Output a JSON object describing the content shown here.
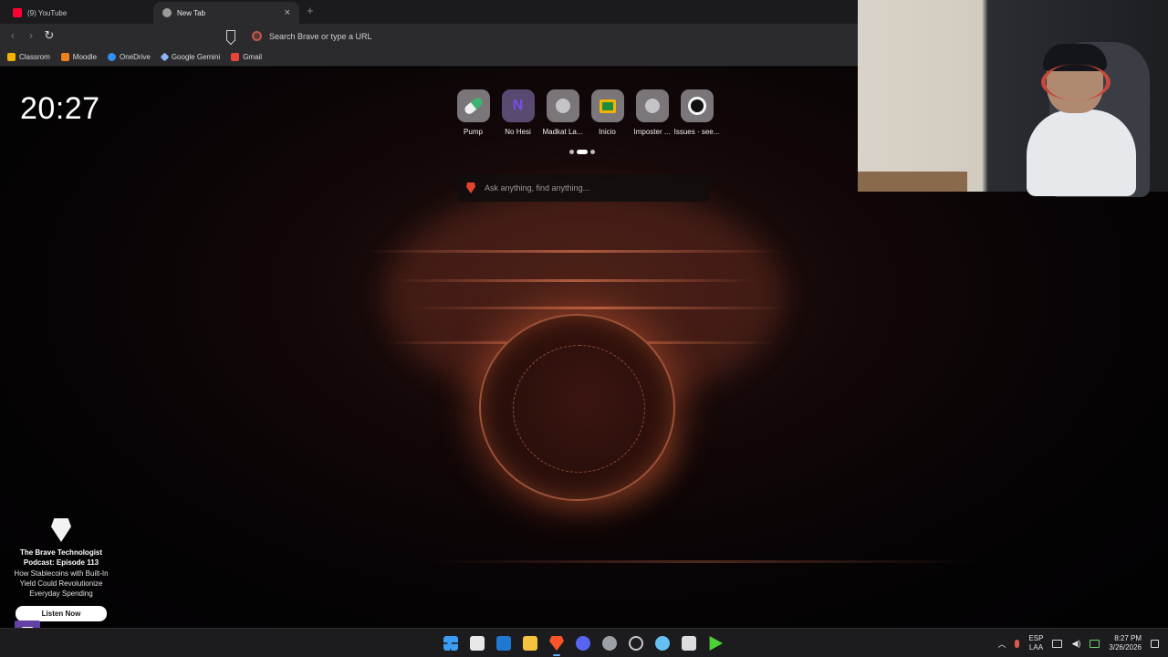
{
  "browser": {
    "tabs": [
      {
        "title": "(9) YouTube",
        "active": false,
        "favicon_color": "#ff0033"
      },
      {
        "title": "New Tab",
        "active": true,
        "favicon_color": "#9a9a9a"
      }
    ],
    "address_placeholder": "Search Brave or type a URL",
    "bookmarks": [
      {
        "label": "Classrom",
        "color": "#f2b400"
      },
      {
        "label": "Moodle",
        "color": "#f0801a"
      },
      {
        "label": "OneDrive",
        "color": "#2f8ff3"
      },
      {
        "label": "Google Gemini",
        "color": "#8ab4f8"
      },
      {
        "label": "Gmail",
        "color": "#ea4335"
      }
    ]
  },
  "new_tab": {
    "clock": "20:27",
    "top_sites": [
      {
        "label": "Pump",
        "icon": "pill-icon"
      },
      {
        "label": "No Hesi",
        "icon": "nohesi-icon"
      },
      {
        "label": "Madkat La...",
        "icon": "globe-icon"
      },
      {
        "label": "Inicio",
        "icon": "classroom-icon"
      },
      {
        "label": "Imposter ...",
        "icon": "globe-icon"
      },
      {
        "label": "Issues · see...",
        "icon": "github-icon"
      }
    ],
    "search_placeholder": "Ask anything, find anything...",
    "promo": {
      "heading": "The Brave Technologist Podcast: Episode 113",
      "description": "How Stablecoins with Built-In Yield Could Revolutionize Everyday Spending",
      "cta": "Listen Now"
    }
  },
  "taskbar": {
    "apps": [
      {
        "name": "windows-start-icon",
        "color": "#3b9cf5"
      },
      {
        "name": "store-icon",
        "color": "#e8e8e8"
      },
      {
        "name": "outlook-icon",
        "color": "#1f78d1"
      },
      {
        "name": "file-explorer-icon",
        "color": "#f3c33f"
      },
      {
        "name": "brave-icon",
        "color": "#fb542b"
      },
      {
        "name": "discord-icon",
        "color": "#5865f2"
      },
      {
        "name": "settings-icon",
        "color": "#9aa0a6"
      },
      {
        "name": "obs-icon",
        "color": "#c9c9c9"
      },
      {
        "name": "steam-icon",
        "color": "#66c0f4"
      },
      {
        "name": "epic-games-icon",
        "color": "#dddddd"
      },
      {
        "name": "play-icon",
        "color": "#4cd137"
      }
    ],
    "language_line1": "ESP",
    "language_line2": "LAA",
    "time": "8:27 PM",
    "date": "3/26/2026"
  }
}
